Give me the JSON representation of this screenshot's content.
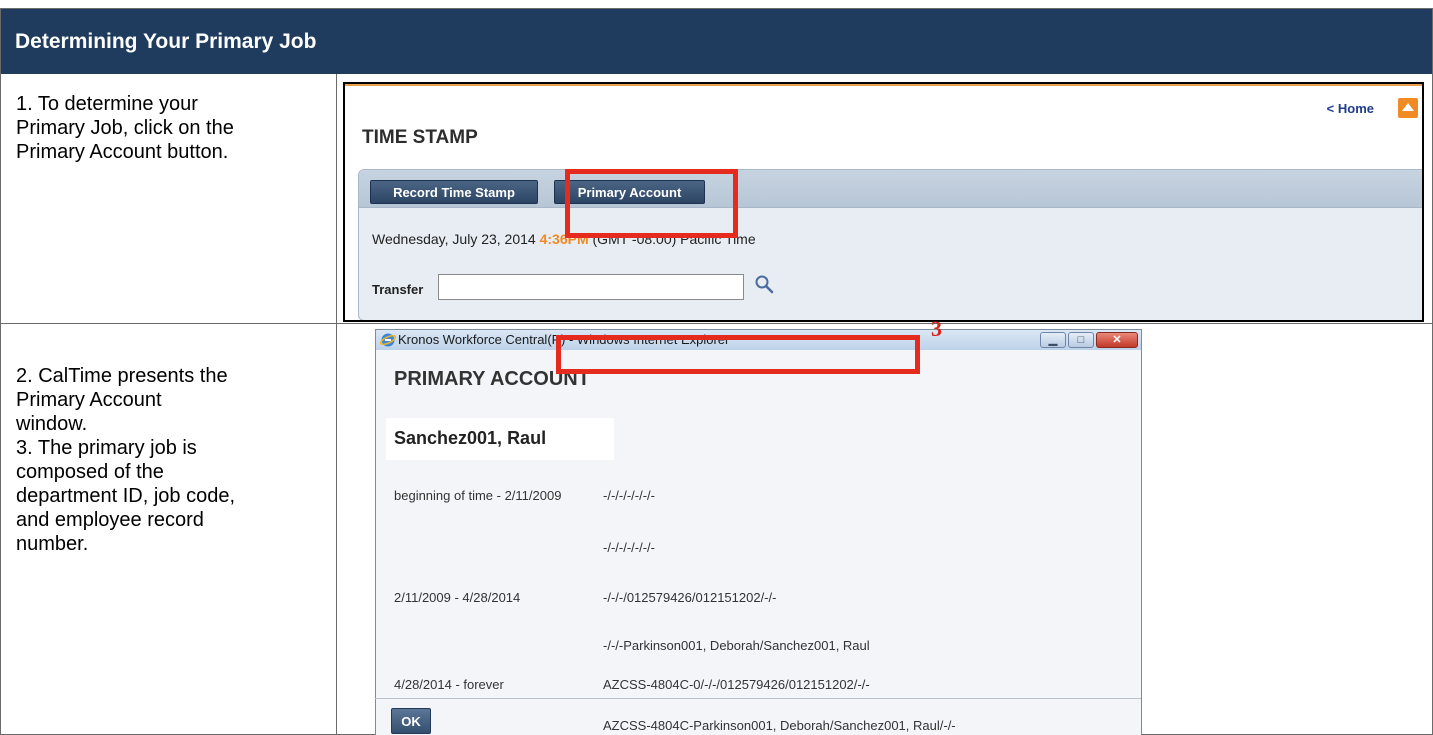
{
  "document": {
    "title": "Determining Your Primary Job"
  },
  "steps": {
    "step1": "1. To determine your\nPrimary Job, click on the\nPrimary Account button.",
    "step2": "2. CalTime presents the\nPrimary Account\nwindow.",
    "step3": "3. The primary job is\ncomposed of the\ndepartment ID, job code,\nand employee record\nnumber."
  },
  "timestamp_screen": {
    "home_link": "< Home",
    "title": "TIME STAMP",
    "record_button": "Record Time Stamp",
    "primary_button": "Primary Account",
    "date_text": "Wednesday, July 23, 2014",
    "time_text": "4:36PM",
    "timezone_text": "(GMT -08:00) Pacific Time",
    "transfer_label": "Transfer",
    "transfer_value": "",
    "accent_color": "#f08a24",
    "header_color": "#1f3c5e"
  },
  "primary_account_window": {
    "window_title": "Kronos Workforce Central(R) - Windows Internet Explorer",
    "heading": "PRIMARY ACCOUNT",
    "employee_name": "Sanchez001, Raul",
    "rows": [
      {
        "range": "beginning of time - 2/11/2009",
        "line1": "-/-/-/-/-/-/-",
        "line2": "-/-/-/-/-/-/-"
      },
      {
        "range": "2/11/2009 - 4/28/2014",
        "line1": "-/-/-/012579426/012151202/-/-",
        "line2": "-/-/-Parkinson001, Deborah/Sanchez001, Raul"
      },
      {
        "range": "4/28/2014 - forever",
        "line1": "AZCSS-4804C-0/-/-/012579426/012151202/-/-",
        "line2": "AZCSS-4804C-Parkinson001, Deborah/Sanchez001, Raul/-/-"
      }
    ],
    "ok_button": "OK",
    "callout": "3"
  }
}
